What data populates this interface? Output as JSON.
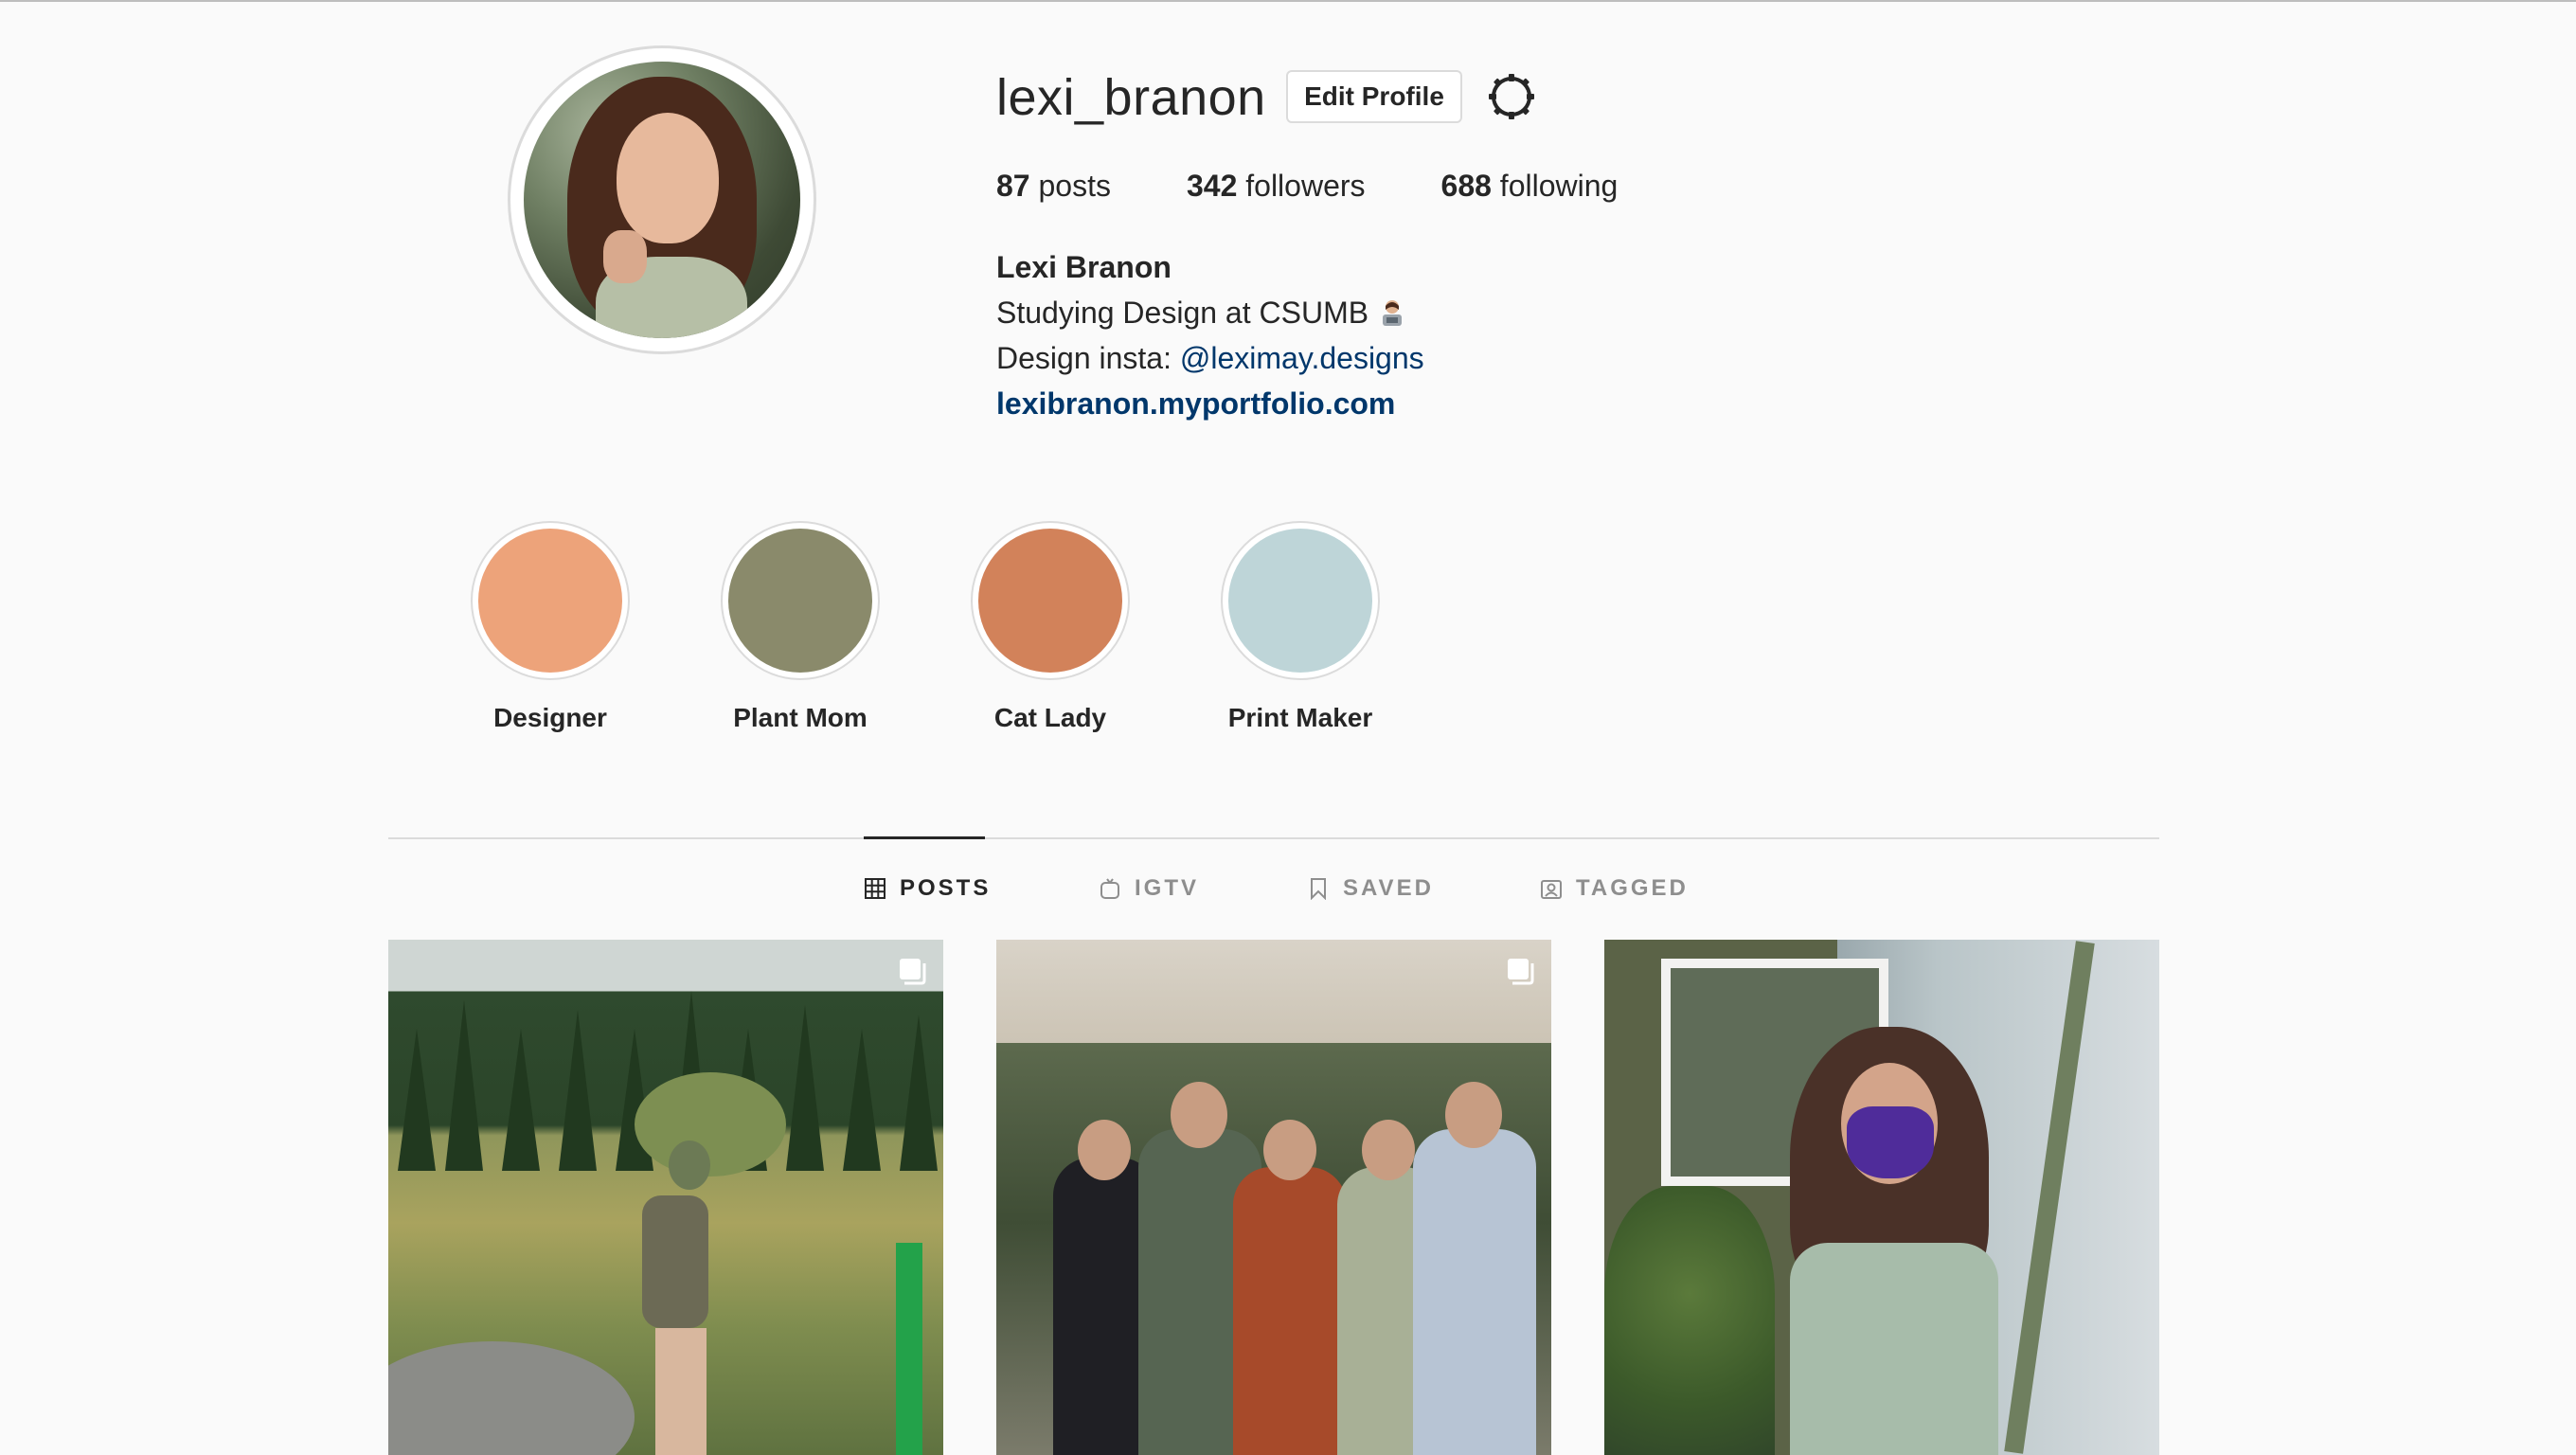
{
  "profile": {
    "username": "lexi_branon",
    "edit_label": "Edit Profile",
    "stats": [
      {
        "count": "87",
        "label": "posts"
      },
      {
        "count": "342",
        "label": "followers"
      },
      {
        "count": "688",
        "label": "following"
      }
    ],
    "full_name": "Lexi Branon",
    "bio_line1": "Studying Design at CSUMB",
    "bio_line2_prefix": "Design insta: ",
    "bio_mention": "@leximay.designs",
    "website": "lexibranon.myportfolio.com"
  },
  "highlights": [
    {
      "label": "Designer",
      "color": "#eda37a"
    },
    {
      "label": "Plant Mom",
      "color": "#8a8a6b"
    },
    {
      "label": "Cat Lady",
      "color": "#d2825a"
    },
    {
      "label": "Print Maker",
      "color": "#bed5d8"
    }
  ],
  "tabs": [
    {
      "label": "POSTS",
      "icon": "grid-icon",
      "active": true
    },
    {
      "label": "IGTV",
      "icon": "igtv-icon",
      "active": false
    },
    {
      "label": "SAVED",
      "icon": "bookmark-icon",
      "active": false
    },
    {
      "label": "TAGGED",
      "icon": "tag-person-icon",
      "active": false
    }
  ],
  "colors": {
    "link": "#00376b",
    "text": "#262626",
    "muted": "#8e8e8e",
    "border": "#dbdbdb"
  }
}
